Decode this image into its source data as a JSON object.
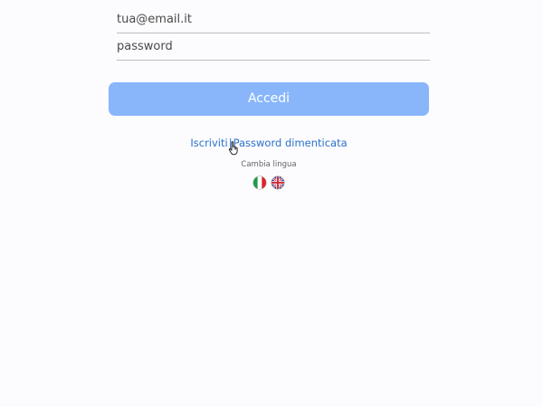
{
  "form": {
    "email_placeholder": "tua@email.it",
    "password_placeholder": "password",
    "login_label": "Accedi"
  },
  "links": {
    "signup_label": "Iscriviti",
    "separator": "|",
    "forgot_password_label": "Password dimenticata"
  },
  "language": {
    "label": "Cambia lingua",
    "options": [
      {
        "icon": "italy-flag-icon"
      },
      {
        "icon": "uk-flag-icon"
      }
    ]
  },
  "colors": {
    "button_bg": "#89b6fb",
    "link": "#2a72c9",
    "background": "#fcfbfe"
  }
}
